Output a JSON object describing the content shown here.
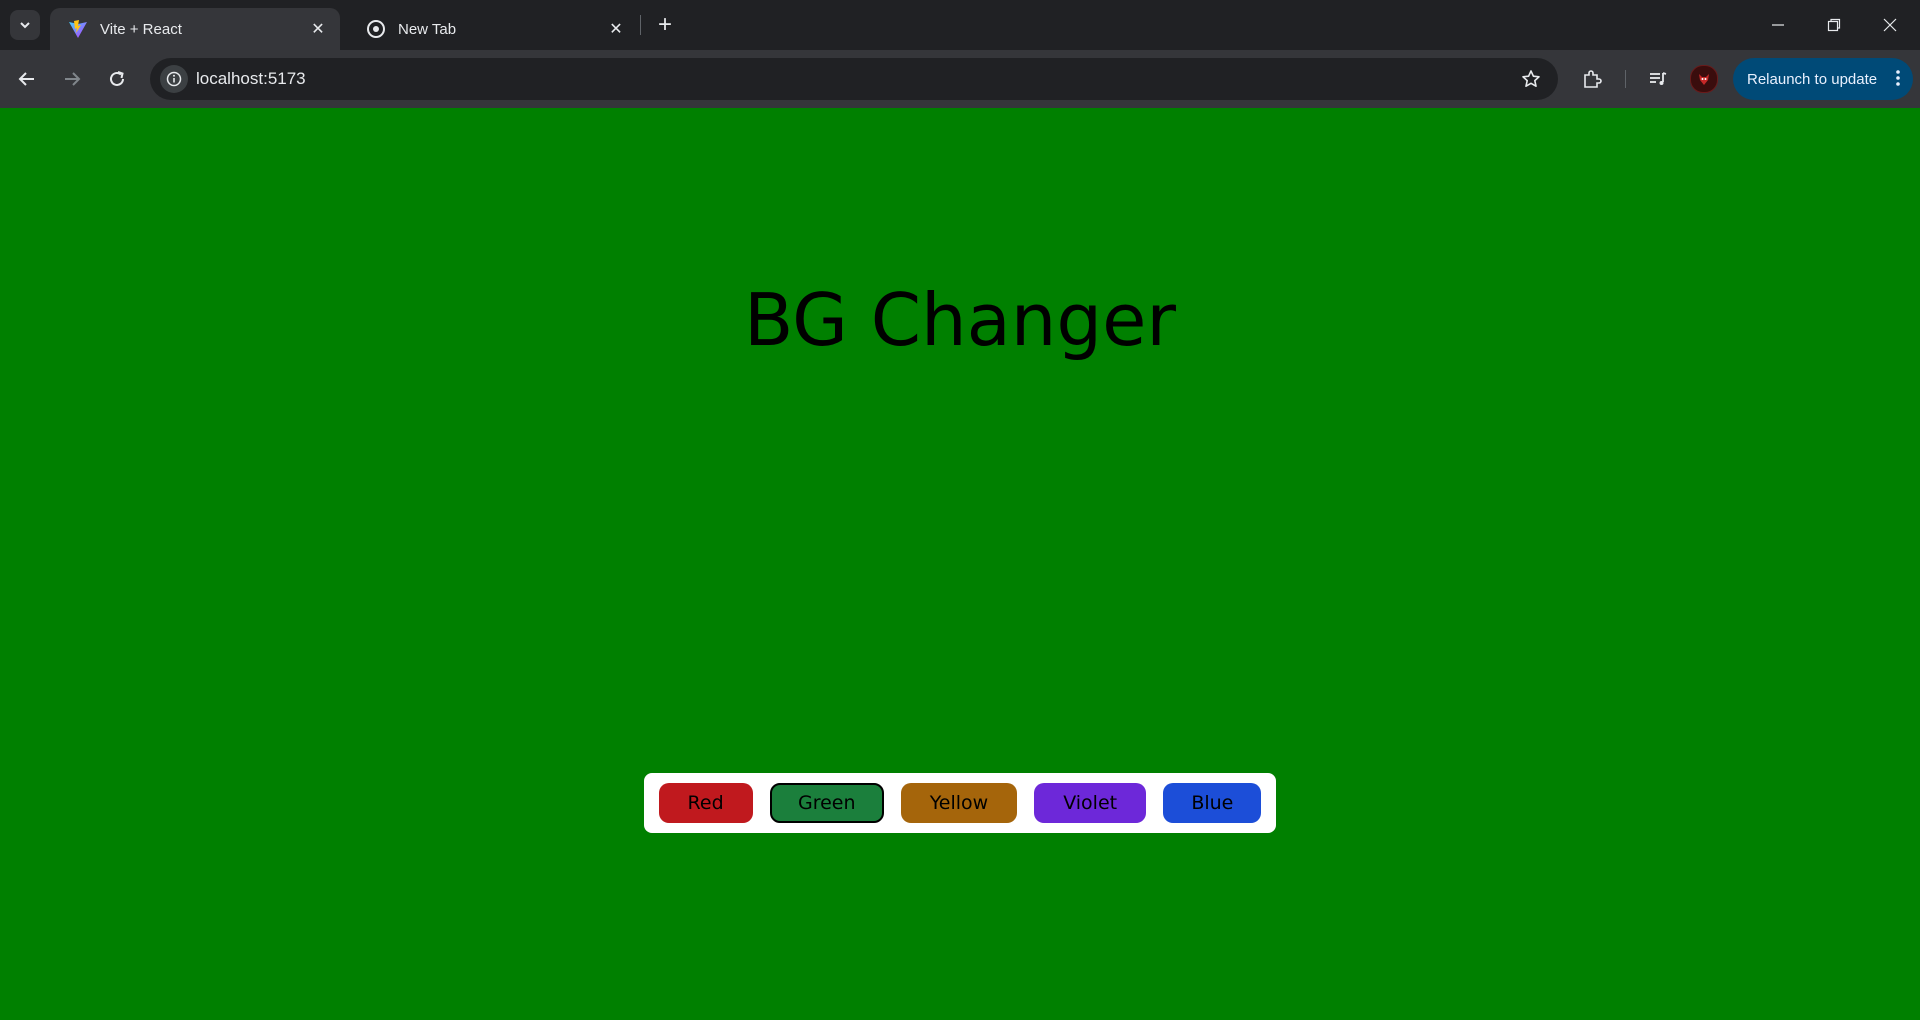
{
  "browser": {
    "tabs": [
      {
        "title": "Vite + React",
        "active": true,
        "favicon": "vite-icon"
      },
      {
        "title": "New Tab",
        "active": false,
        "favicon": "chrome-icon"
      }
    ],
    "address_bar": {
      "url": "localhost:5173"
    },
    "relaunch_label": "Relaunch to update",
    "accent_color": "#004a77"
  },
  "page": {
    "background_color": "#008000",
    "title": "BG Changer",
    "color_buttons": [
      {
        "label": "Red",
        "color": "#c0191e"
      },
      {
        "label": "Green",
        "color": "#1b7f3c",
        "focused": true
      },
      {
        "label": "Yellow",
        "color": "#a5650b"
      },
      {
        "label": "Violet",
        "color": "#6d28d9"
      },
      {
        "label": "Blue",
        "color": "#1c4ed8"
      }
    ]
  }
}
